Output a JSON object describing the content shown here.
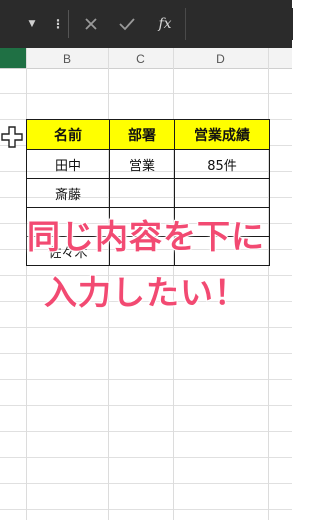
{
  "formula_bar": {
    "fx_label": "fx"
  },
  "columns": [
    "B",
    "C",
    "D"
  ],
  "table": {
    "headers": [
      "名前",
      "部署",
      "営業成績"
    ],
    "rows": [
      [
        "田中",
        "営業",
        "85件"
      ],
      [
        "斎藤",
        "",
        ""
      ],
      [
        "",
        "",
        ""
      ],
      [
        "佐々木",
        "",
        ""
      ]
    ]
  },
  "overlay": {
    "line1": "同じ内容を下に",
    "line2": "入力したい！",
    "color": "#f24a72"
  }
}
